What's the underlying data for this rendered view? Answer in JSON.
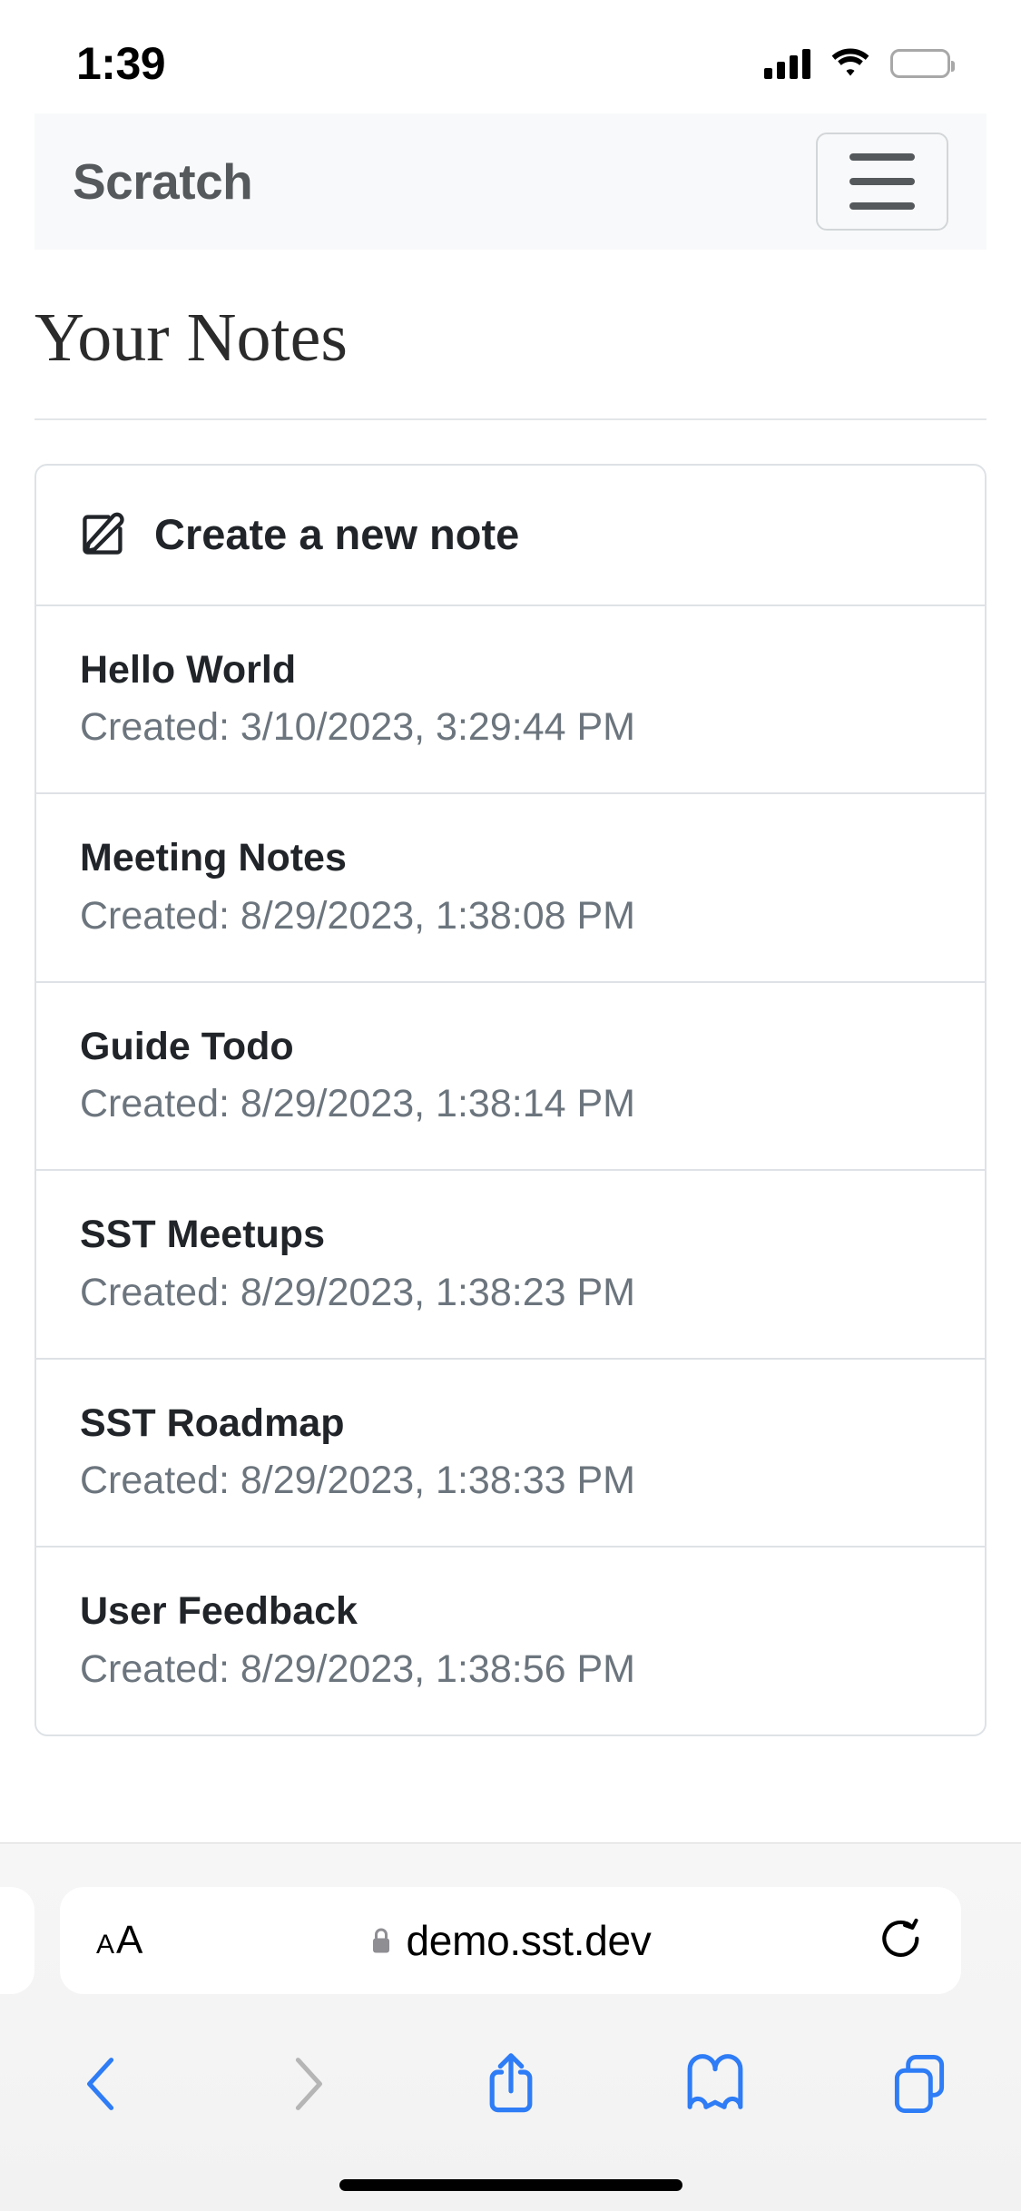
{
  "status_bar": {
    "time": "1:39",
    "cellular_icon": "cellular-signal-icon",
    "wifi_icon": "wifi-icon",
    "battery_icon": "battery-icon"
  },
  "navbar": {
    "brand": "Scratch",
    "menu_icon": "hamburger-menu-icon"
  },
  "main": {
    "page_title": "Your Notes",
    "create_note": {
      "label": "Create a new note",
      "icon": "pencil-square-icon"
    },
    "notes": [
      {
        "title": "Hello World",
        "created": "Created: 3/10/2023, 3:29:44 PM"
      },
      {
        "title": "Meeting Notes",
        "created": "Created: 8/29/2023, 1:38:08 PM"
      },
      {
        "title": "Guide Todo",
        "created": "Created: 8/29/2023, 1:38:14 PM"
      },
      {
        "title": "SST Meetups",
        "created": "Created: 8/29/2023, 1:38:23 PM"
      },
      {
        "title": "SST Roadmap",
        "created": "Created: 8/29/2023, 1:38:33 PM"
      },
      {
        "title": "User Feedback",
        "created": "Created: 8/29/2023, 1:38:56 PM"
      }
    ]
  },
  "browser": {
    "text_size_small": "A",
    "text_size_large": "A",
    "lock_icon": "lock-icon",
    "url": "demo.sst.dev",
    "reload_icon": "reload-icon",
    "toolbar": [
      {
        "name": "back-button",
        "icon": "chevron-left-icon",
        "enabled": "true"
      },
      {
        "name": "forward-button",
        "icon": "chevron-right-icon",
        "enabled": "false"
      },
      {
        "name": "share-button",
        "icon": "share-icon",
        "enabled": "true"
      },
      {
        "name": "bookmarks-button",
        "icon": "book-icon",
        "enabled": "true"
      },
      {
        "name": "tabs-button",
        "icon": "tabs-icon",
        "enabled": "true"
      }
    ]
  },
  "colors": {
    "accent_blue": "#2e7cf6",
    "disabled_gray": "#b5b5b5",
    "brand_gray": "#55595c",
    "border_gray": "#dee2e6",
    "muted_text": "#6c757d"
  }
}
